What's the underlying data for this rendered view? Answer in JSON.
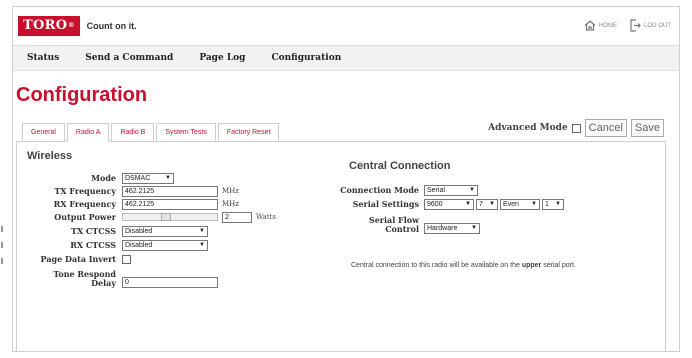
{
  "header": {
    "logo_text": "TORO",
    "logo_reg": "®",
    "tagline": "Count on it.",
    "home_label": "HOME",
    "logout_label": "LOG OUT"
  },
  "nav": {
    "items": [
      {
        "label": "Status"
      },
      {
        "label": "Send a Command"
      },
      {
        "label": "Page Log"
      },
      {
        "label": "Configuration"
      }
    ]
  },
  "page": {
    "title": "Configuration"
  },
  "tabs": [
    {
      "label": "General",
      "active": false
    },
    {
      "label": "Radio A",
      "active": true
    },
    {
      "label": "Radio B",
      "active": false
    },
    {
      "label": "System Tests",
      "active": false
    },
    {
      "label": "Factory Reset",
      "active": false
    }
  ],
  "toolbar": {
    "advanced_mode_label": "Advanced Mode",
    "advanced_mode_checked": false,
    "cancel_label": "Cancel",
    "save_label": "Save"
  },
  "wireless": {
    "title": "Wireless",
    "mode": {
      "label": "Mode",
      "value": "DSMAC"
    },
    "tx_frequency": {
      "label": "TX Frequency",
      "value": "462.2125",
      "unit": "MHz"
    },
    "rx_frequency": {
      "label": "RX Frequency",
      "value": "462.2125",
      "unit": "MHz"
    },
    "output_power": {
      "label": "Output Power",
      "value": "2",
      "unit": "Watts"
    },
    "tx_ctcss": {
      "label": "TX CTCSS",
      "value": "Disabled"
    },
    "rx_ctcss": {
      "label": "RX CTCSS",
      "value": "Disabled"
    },
    "page_data_invert": {
      "label": "Page Data Invert",
      "checked": false
    },
    "tone_respond_delay": {
      "label_line1": "Tone Respond",
      "label_line2": "Delay",
      "value": "0"
    }
  },
  "central": {
    "title": "Central Connection",
    "connection_mode": {
      "label": "Connection Mode",
      "value": "Serial"
    },
    "serial_settings": {
      "label": "Serial Settings",
      "baud": "9600",
      "data_bits": "7",
      "parity": "Even",
      "stop_bits": "1"
    },
    "flow_control": {
      "label_line1": "Serial Flow",
      "label_line2": "Control",
      "value": "Hardware"
    },
    "note_prefix": "Central connection to this radio will be available on the ",
    "note_bold": "upper",
    "note_suffix": " serial port."
  },
  "colors": {
    "brand_red": "#c8102e",
    "nav_bg": "#f2f2f2",
    "border": "#cfcfcf"
  }
}
